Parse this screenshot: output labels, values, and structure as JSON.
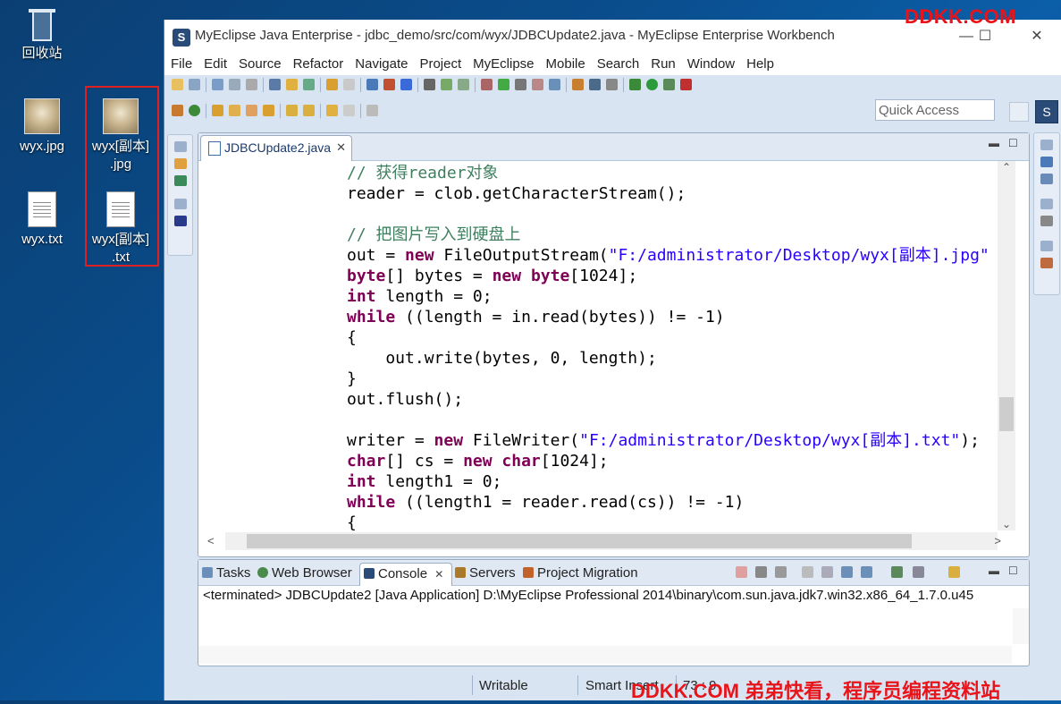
{
  "desktop": {
    "icons": [
      {
        "label": "回收站",
        "icon": "recycle-bin-icon"
      },
      {
        "label": "wyx.jpg",
        "icon": "image-file-icon"
      },
      {
        "label": "wyx[副本]",
        "label2": ".jpg",
        "icon": "image-file-icon"
      },
      {
        "label": "wyx.txt",
        "icon": "text-file-icon"
      },
      {
        "label": "wyx[副本]",
        "label2": ".txt",
        "icon": "text-file-icon"
      }
    ]
  },
  "window": {
    "title": "MyEclipse Java Enterprise - jdbc_demo/src/com/wyx/JDBCUpdate2.java - MyEclipse Enterprise Workbench",
    "controls": {
      "minimize": "—",
      "maximize": "☐",
      "close": "✕"
    }
  },
  "menu": [
    "File",
    "Edit",
    "Source",
    "Refactor",
    "Navigate",
    "Project",
    "MyEclipse",
    "Mobile",
    "Search",
    "Run",
    "Window",
    "Help"
  ],
  "quick_access": {
    "placeholder": "Quick Access"
  },
  "editor": {
    "tab_label": "JDBCUpdate2.java",
    "tab_close": "✕",
    "lines": [
      [
        {
          "t": "// 获得reader对象",
          "c": "cm"
        }
      ],
      [
        {
          "t": "reader = clob.getCharacterStream();",
          "c": ""
        }
      ],
      [
        {
          "t": "",
          "c": ""
        }
      ],
      [
        {
          "t": "// 把图片写入到硬盘上",
          "c": "cm"
        }
      ],
      [
        {
          "t": "out = ",
          "c": ""
        },
        {
          "t": "new",
          "c": "kw"
        },
        {
          "t": " FileOutputStream(",
          "c": ""
        },
        {
          "t": "\"F:/administrator/Desktop/wyx[副本].jpg\"",
          "c": "str"
        }
      ],
      [
        {
          "t": "byte",
          "c": "kw"
        },
        {
          "t": "[] bytes = ",
          "c": ""
        },
        {
          "t": "new",
          "c": "kw"
        },
        {
          "t": " ",
          "c": ""
        },
        {
          "t": "byte",
          "c": "kw"
        },
        {
          "t": "[1024];",
          "c": ""
        }
      ],
      [
        {
          "t": "int",
          "c": "kw"
        },
        {
          "t": " length = 0;",
          "c": ""
        }
      ],
      [
        {
          "t": "while",
          "c": "kw"
        },
        {
          "t": " ((length = in.read(bytes)) != -1)",
          "c": ""
        }
      ],
      [
        {
          "t": "{",
          "c": ""
        }
      ],
      [
        {
          "t": "    out.write(bytes, 0, length);",
          "c": ""
        }
      ],
      [
        {
          "t": "}",
          "c": ""
        }
      ],
      [
        {
          "t": "out.flush();",
          "c": ""
        }
      ],
      [
        {
          "t": "",
          "c": ""
        }
      ],
      [
        {
          "t": "writer = ",
          "c": ""
        },
        {
          "t": "new",
          "c": "kw"
        },
        {
          "t": " FileWriter(",
          "c": ""
        },
        {
          "t": "\"F:/administrator/Desktop/wyx[副本].txt\"",
          "c": "str"
        },
        {
          "t": ");",
          "c": ""
        }
      ],
      [
        {
          "t": "char",
          "c": "kw"
        },
        {
          "t": "[] cs = ",
          "c": ""
        },
        {
          "t": "new",
          "c": "kw"
        },
        {
          "t": " ",
          "c": ""
        },
        {
          "t": "char",
          "c": "kw"
        },
        {
          "t": "[1024];",
          "c": ""
        }
      ],
      [
        {
          "t": "int",
          "c": "kw"
        },
        {
          "t": " length1 = 0;",
          "c": ""
        }
      ],
      [
        {
          "t": "while",
          "c": "kw"
        },
        {
          "t": " ((length1 = reader.read(cs)) != -1)",
          "c": ""
        }
      ],
      [
        {
          "t": "{",
          "c": ""
        }
      ]
    ]
  },
  "console_panel": {
    "tabs": [
      {
        "label": "Tasks",
        "icon": "tasks-icon",
        "color": "#6a8fb8"
      },
      {
        "label": "Web Browser",
        "icon": "globe-icon",
        "color": "#4a8a4a"
      },
      {
        "label": "Console",
        "icon": "console-icon",
        "color": "#2a4a78",
        "active": true
      },
      {
        "label": "Servers",
        "icon": "servers-icon",
        "color": "#a87a2a"
      },
      {
        "label": "Project Migration",
        "icon": "migration-icon",
        "color": "#c0622a"
      }
    ],
    "tab_close": "✕",
    "output": "<terminated> JDBCUpdate2 [Java Application] D:\\MyEclipse Professional 2014\\binary\\com.sun.java.jdk7.win32.x86_64_1.7.0.u45"
  },
  "status": {
    "writable": "Writable",
    "insert_mode": "Smart Insert",
    "position": "73 : 9"
  },
  "watermarks": {
    "top": "DDKK.COM",
    "bottom": "DDKK.COM 弟弟快看，程序员编程资料站"
  }
}
